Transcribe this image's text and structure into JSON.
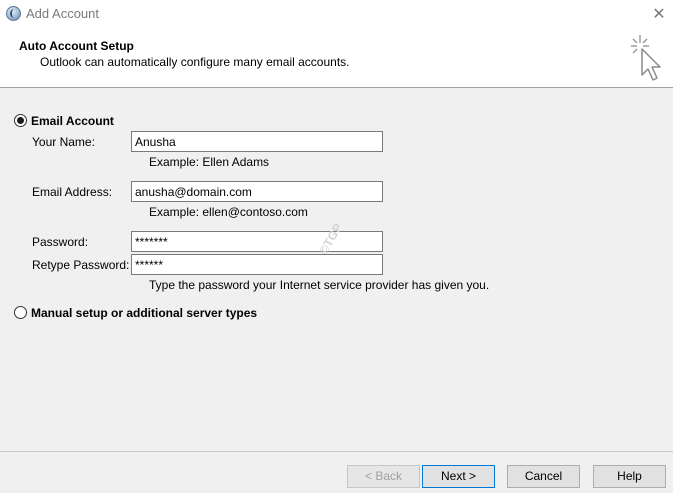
{
  "window": {
    "title": "Add Account",
    "icon": "outlook-globe-icon",
    "close_glyph": "✕"
  },
  "header": {
    "title": "Auto Account Setup",
    "subtitle": "Outlook can automatically configure many email accounts.",
    "icon": "cursor-sparkle-icon"
  },
  "options": {
    "email_account_label": "Email Account",
    "manual_setup_label": "Manual setup or additional server types",
    "selected": "email_account"
  },
  "form": {
    "name_label": "Your Name:",
    "name_value": "Anusha",
    "name_hint": "Example: Ellen Adams",
    "email_label": "Email Address:",
    "email_value": "anusha@domain.com",
    "email_hint": "Example: ellen@contoso.com",
    "password_label": "Password:",
    "password_value": "*******",
    "retype_label": "Retype Password:",
    "retype_value": "******",
    "password_hint": "Type the password your Internet service provider has given you."
  },
  "watermark": "©TGP",
  "buttons": {
    "back": "< Back",
    "next": "Next >",
    "cancel": "Cancel",
    "help": "Help"
  }
}
